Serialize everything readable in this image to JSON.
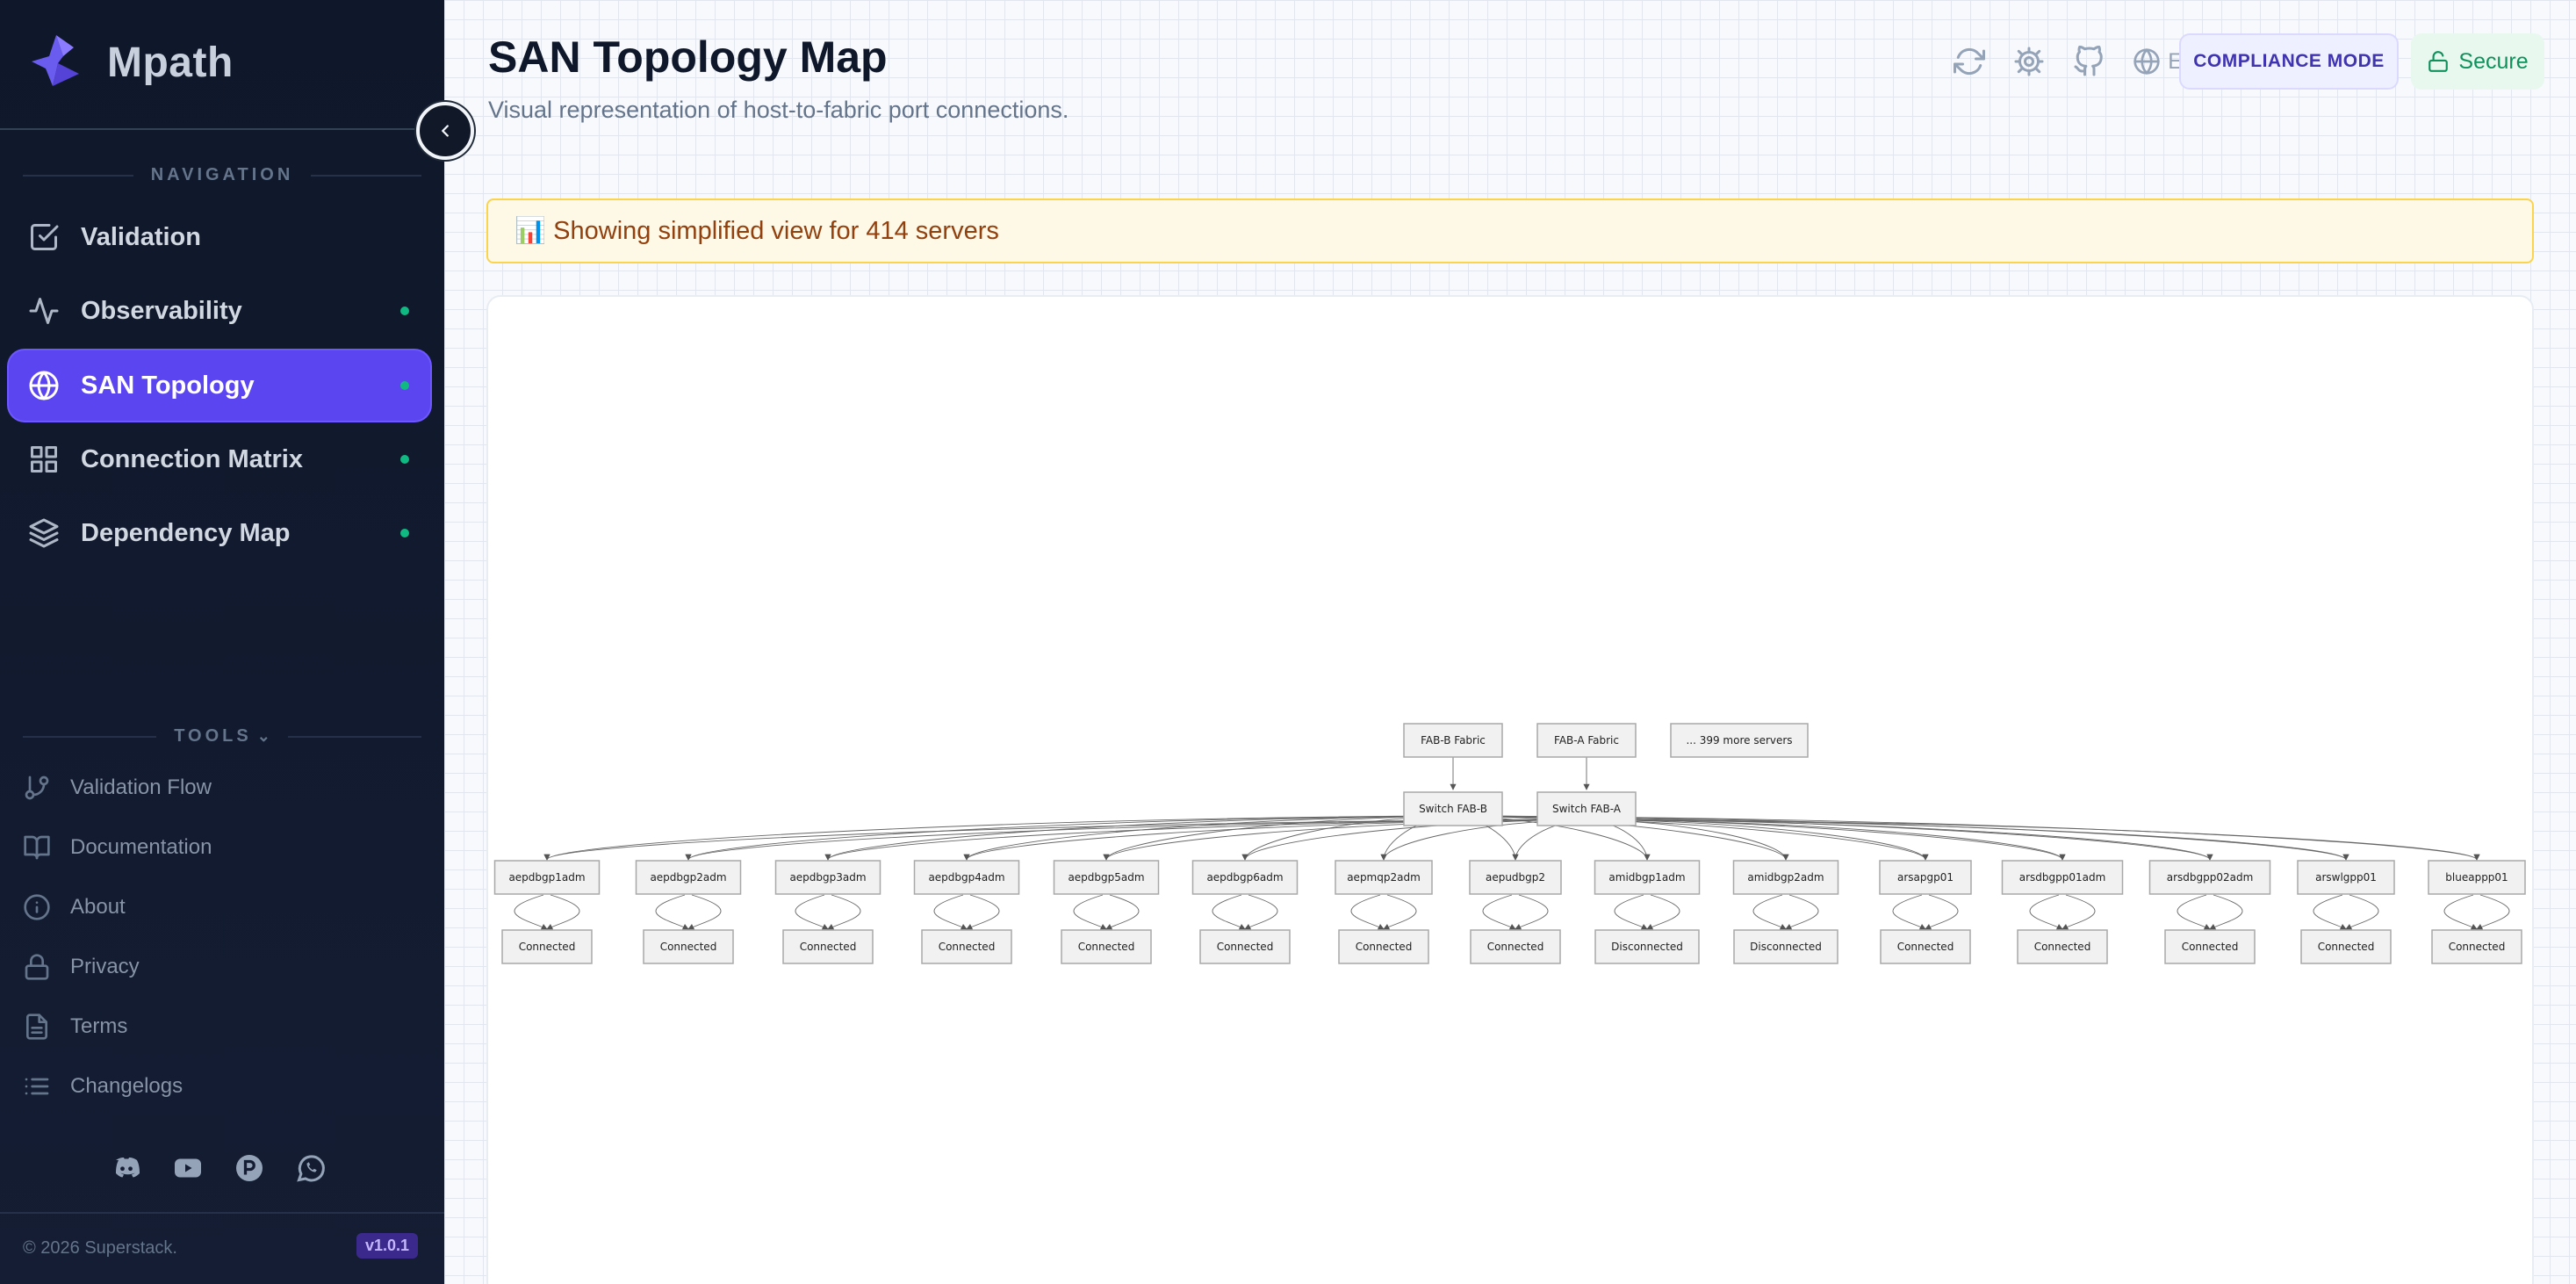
{
  "brand": {
    "name": "Mpath",
    "logo_icon": "mpath-arrow-logo-icon"
  },
  "sidebar": {
    "collapse_icon": "chevron-left-icon",
    "nav_label": "NAVIGATION",
    "nav_items": [
      {
        "label": "Validation",
        "icon": "check-square-icon",
        "active": false,
        "dot": false
      },
      {
        "label": "Observability",
        "icon": "activity-icon",
        "active": false,
        "dot": true
      },
      {
        "label": "SAN Topology",
        "icon": "globe-icon",
        "active": true,
        "dot": true
      },
      {
        "label": "Connection Matrix",
        "icon": "grid-icon",
        "active": false,
        "dot": true
      },
      {
        "label": "Dependency Map",
        "icon": "layers-icon",
        "active": false,
        "dot": true
      }
    ],
    "tools_label": "TOOLS",
    "tools_chevron_icon": "chevron-down-icon",
    "tools": [
      {
        "label": "Validation Flow",
        "icon": "git-branch-icon"
      },
      {
        "label": "Documentation",
        "icon": "book-icon"
      },
      {
        "label": "About",
        "icon": "info-icon"
      },
      {
        "label": "Privacy",
        "icon": "lock-icon"
      },
      {
        "label": "Terms",
        "icon": "file-text-icon"
      },
      {
        "label": "Changelogs",
        "icon": "list-icon"
      }
    ],
    "social_icons": [
      "discord-icon",
      "youtube-icon",
      "patreon-icon",
      "whatsapp-icon"
    ],
    "copyright": "© 2026 Superstack.",
    "version": "v1.0.1"
  },
  "header": {
    "title": "SAN Topology Map",
    "subtitle": "Visual representation of host-to-fabric port connections.",
    "icons": [
      "refresh-icon",
      "settings-icon",
      "github-icon",
      "globe-icon"
    ],
    "language": "EN",
    "compliance_label": "COMPLIANCE MODE",
    "secure_label": "Secure",
    "secure_icon": "lock-open-icon"
  },
  "banner": {
    "icon": "bar-chart-emoji",
    "text": "📊 Showing simplified view for 414 servers"
  },
  "topology": {
    "fabrics": [
      {
        "id": "fabB",
        "label": "FAB-B Fabric"
      },
      {
        "id": "fabA",
        "label": "FAB-A Fabric"
      }
    ],
    "more_servers": "... 399 more servers",
    "switches": [
      {
        "id": "swB",
        "label": "Switch FAB-B",
        "fabric": "fabB"
      },
      {
        "id": "swA",
        "label": "Switch FAB-A",
        "fabric": "fabA"
      }
    ],
    "servers": [
      {
        "name": "aepdbgp1adm",
        "status": "Connected"
      },
      {
        "name": "aepdbgp2adm",
        "status": "Connected"
      },
      {
        "name": "aepdbgp3adm",
        "status": "Connected"
      },
      {
        "name": "aepdbgp4adm",
        "status": "Connected"
      },
      {
        "name": "aepdbgp5adm",
        "status": "Connected"
      },
      {
        "name": "aepdbgp6adm",
        "status": "Connected"
      },
      {
        "name": "aepmqp2adm",
        "status": "Connected"
      },
      {
        "name": "aepudbgp2",
        "status": "Connected"
      },
      {
        "name": "amidbgp1adm",
        "status": "Disconnected"
      },
      {
        "name": "amidbgp2adm",
        "status": "Disconnected"
      },
      {
        "name": "arsapgp01",
        "status": "Connected"
      },
      {
        "name": "arsdbgpp01adm",
        "status": "Connected"
      },
      {
        "name": "arsdbgpp02adm",
        "status": "Connected"
      },
      {
        "name": "arswlgpp01",
        "status": "Connected"
      },
      {
        "name": "blueappp01",
        "status": "Connected"
      }
    ]
  }
}
